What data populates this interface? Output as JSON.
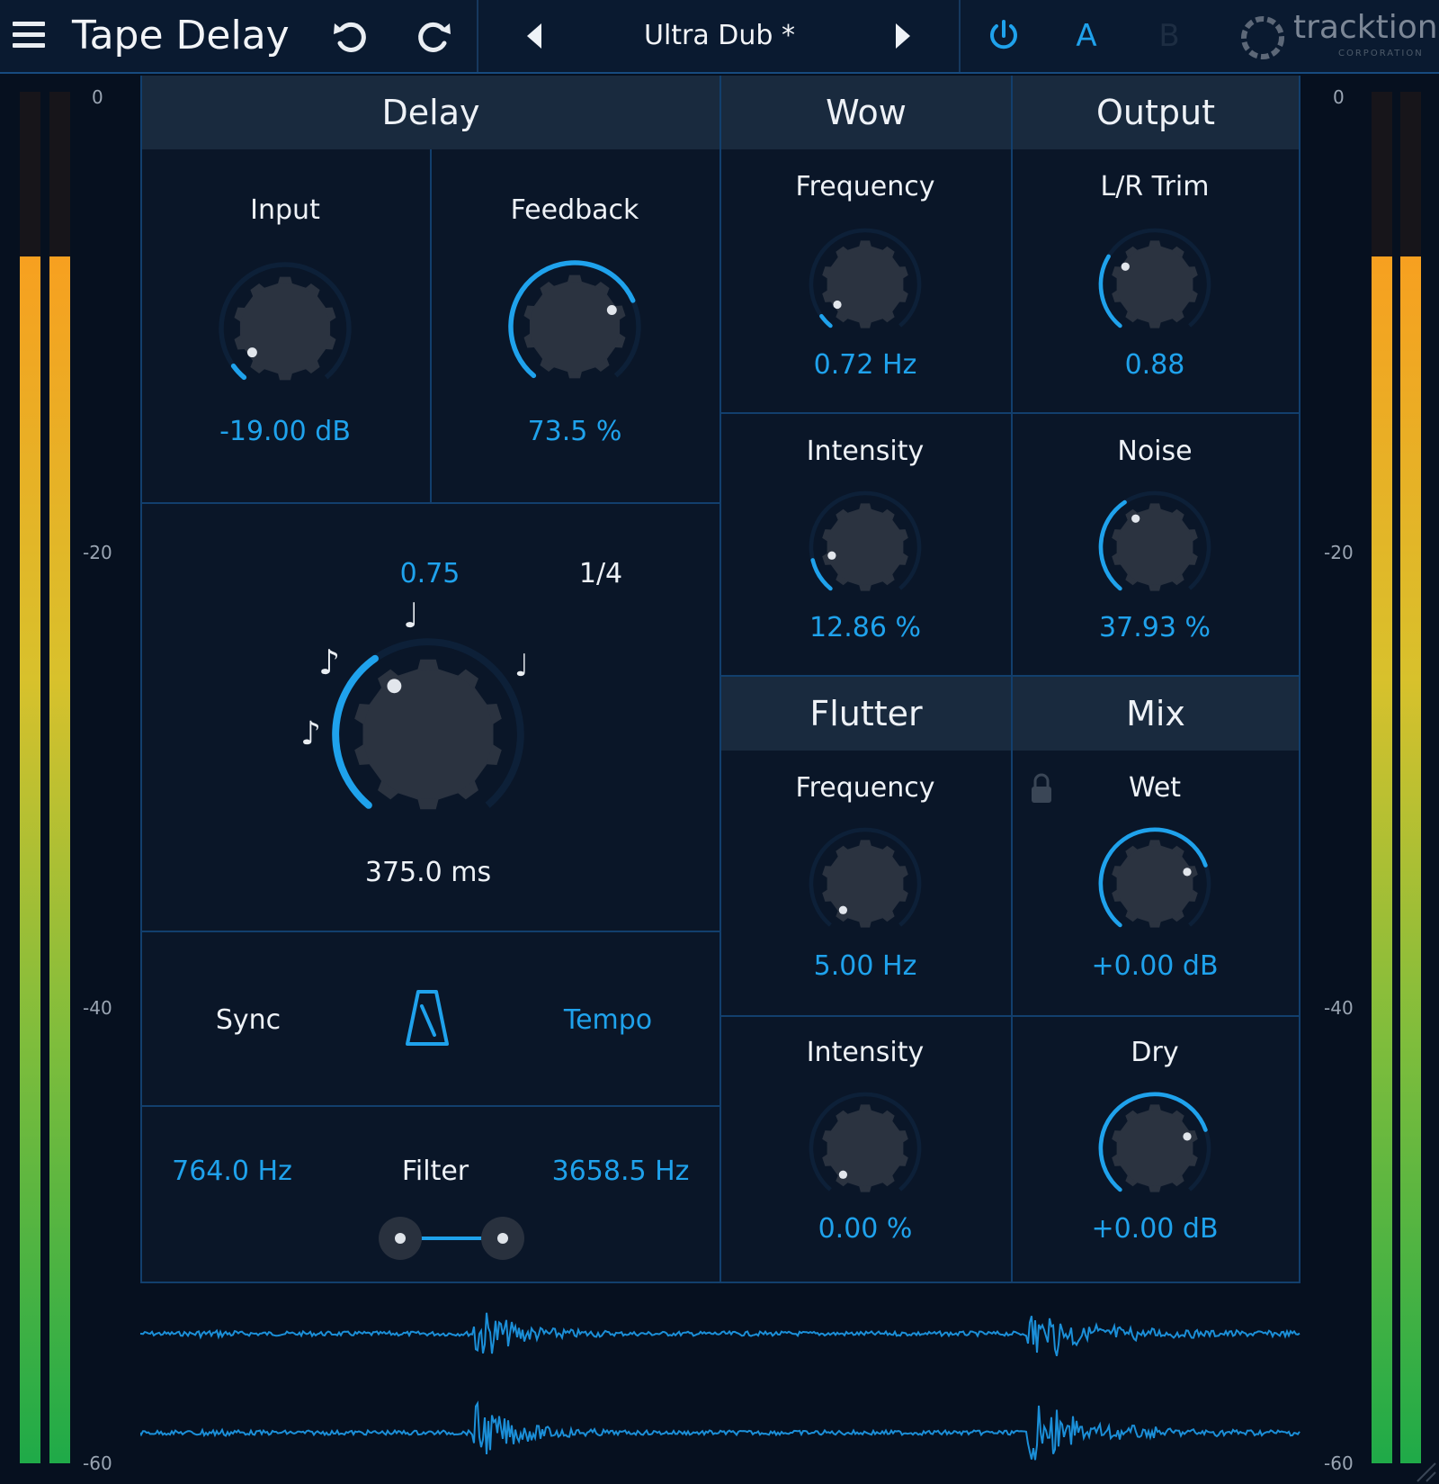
{
  "header": {
    "title": "Tape Delay",
    "preset": "Ultra Dub *",
    "ab_a": "A",
    "ab_b": "B",
    "brand": "tracktion",
    "brand_sub": "CORPORATION"
  },
  "meters": {
    "scale": [
      "0",
      "-20",
      "-40",
      "-60"
    ],
    "left_levels": [
      0.88,
      0.88
    ],
    "right_levels": [
      0.88,
      0.88
    ]
  },
  "delay": {
    "title": "Delay",
    "input": {
      "label": "Input",
      "value": "-19.00 dB",
      "level": 0.05
    },
    "feedback": {
      "label": "Feedback",
      "value": "73.5 %",
      "level": 0.735
    },
    "time": {
      "value": "375.0 ms",
      "ratio": "0.75",
      "division": "1/4",
      "level": 0.375
    },
    "sync": {
      "label": "Sync",
      "mode": "Tempo"
    },
    "filter": {
      "label": "Filter",
      "low": "764.0 Hz",
      "high": "3658.5 Hz"
    }
  },
  "wow": {
    "title": "Wow",
    "frequency": {
      "label": "Frequency",
      "value": "0.72 Hz",
      "level": 0.05
    },
    "intensity": {
      "label": "Intensity",
      "value": "12.86 %",
      "level": 0.1286
    }
  },
  "output": {
    "title": "Output",
    "trim": {
      "label": "L/R Trim",
      "value": "0.88",
      "level": 0.29
    },
    "noise": {
      "label": "Noise",
      "value": "37.93 %",
      "level": 0.3793
    }
  },
  "flutter": {
    "title": "Flutter",
    "frequency": {
      "label": "Frequency",
      "value": "5.00 Hz",
      "level": 0.0
    },
    "intensity": {
      "label": "Intensity",
      "value": "0.00 %",
      "level": 0.0
    }
  },
  "mix": {
    "title": "Mix",
    "wet": {
      "label": "Wet",
      "value": "+0.00 dB",
      "level": 0.75
    },
    "dry": {
      "label": "Dry",
      "value": "+0.00 dB",
      "level": 0.75
    }
  },
  "colors": {
    "accent": "#1fa2ec",
    "arc_track": "#0d2038",
    "knob_body": "#2b3340",
    "knob_dot": "#e2e6ec",
    "panel": "#0a1628",
    "header": "#0a1a30",
    "wave": "#1b8fd8"
  }
}
